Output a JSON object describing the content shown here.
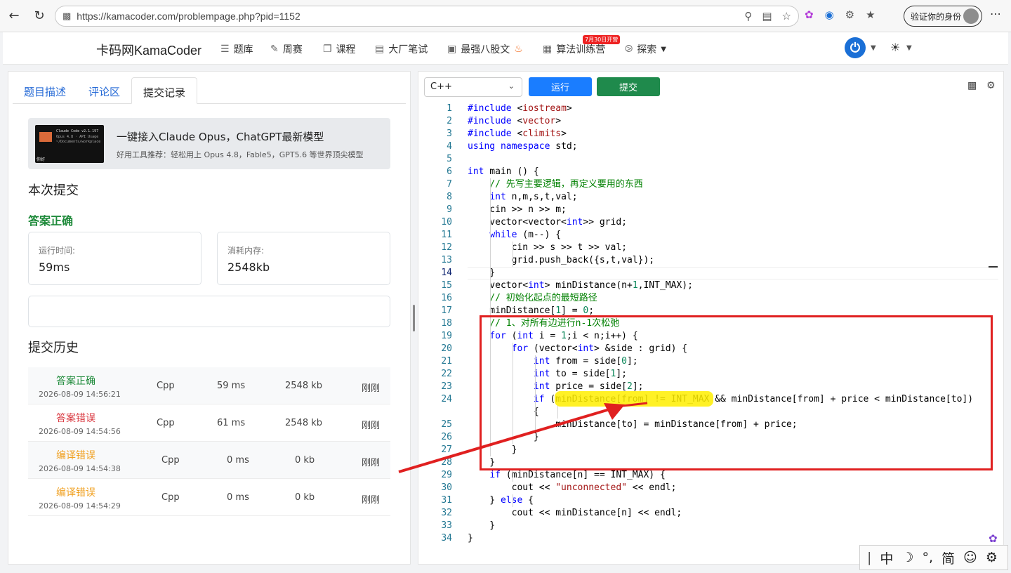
{
  "browser": {
    "url": "https://kamacoder.com/problempage.php?pid=1152",
    "profile_label": "验证你的身份"
  },
  "site": {
    "brand": "卡码网KamaCoder",
    "nav": [
      {
        "label": "题库",
        "icon": "list-icon"
      },
      {
        "label": "周赛",
        "icon": "pencil-icon"
      },
      {
        "label": "课程",
        "icon": "copy-icon"
      },
      {
        "label": "大厂笔试",
        "icon": "document-icon"
      },
      {
        "label": "最强八股文",
        "icon": "book-icon"
      },
      {
        "label": "算法训练营",
        "icon": "calendar-icon"
      },
      {
        "label": "探索",
        "icon": "compass-icon"
      }
    ],
    "badge": "7月30日开营"
  },
  "left": {
    "tabs": [
      "题目描述",
      "评论区",
      "提交记录"
    ],
    "ad": {
      "title": "一键接入Claude Opus，ChatGPT最新模型",
      "subtitle": "好用工具推荐：轻松用上 Opus 4.8，Fable5，GPT5.6 等世界顶尖模型",
      "thumb_line1": "Claude Code v2.1.197",
      "thumb_line2": "Opus 4.8 · API Usage",
      "thumb_line3": "~/Documents/workplace",
      "thumb_caption": "你好"
    },
    "current_title": "本次提交",
    "status": "答案正确",
    "runtime_label": "运行时间:",
    "runtime_value": "59ms",
    "memory_label": "消耗内存:",
    "memory_value": "2548kb",
    "history_title": "提交历史",
    "history": [
      {
        "status": "答案正确",
        "time": "2026-08-09 14:56:21",
        "lang": "Cpp",
        "ms": "59 ms",
        "kb": "2548 kb",
        "when": "刚刚"
      },
      {
        "status": "答案错误",
        "time": "2026-08-09 14:54:56",
        "lang": "Cpp",
        "ms": "61 ms",
        "kb": "2548 kb",
        "when": "刚刚"
      },
      {
        "status": "编译错误",
        "time": "2026-08-09 14:54:38",
        "lang": "Cpp",
        "ms": "0 ms",
        "kb": "0 kb",
        "when": "刚刚"
      },
      {
        "status": "编译错误",
        "time": "2026-08-09 14:54:29",
        "lang": "Cpp",
        "ms": "0 ms",
        "kb": "0 kb",
        "when": "刚刚"
      }
    ]
  },
  "editor": {
    "language": "C++",
    "run_label": "运行",
    "submit_label": "提交",
    "lines": [
      "#include <iostream>",
      "#include <vector>",
      "#include <climits>",
      "using namespace std;",
      "",
      "int main () {",
      "    // 先写主要逻辑，再定义要用的东西",
      "    int n,m,s,t,val;",
      "    cin >> n >> m;",
      "    vector<vector<int>> grid;",
      "    while (m--) {",
      "        cin >> s >> t >> val;",
      "        grid.push_back({s,t,val});",
      "    }",
      "    vector<int> minDistance(n+1,INT_MAX);",
      "    // 初始化起点的最短路径",
      "    minDistance[1] = 0;",
      "    // 1、对所有边进行n-1次松弛",
      "    for (int i = 1;i < n;i++) {",
      "        for (vector<int> &side : grid) {",
      "            int from = side[0];",
      "            int to = side[1];",
      "            int price = side[2];",
      "            if (minDistance[from] != INT_MAX && minDistance[from] + price < minDistance[to])",
      "            {",
      "                minDistance[to] = minDistance[from] + price;",
      "            }",
      "        }",
      "    }",
      "    if (minDistance[n] == INT_MAX) {",
      "        cout << \"unconnected\" << endl;",
      "    } else {",
      "        cout << minDistance[n] << endl;",
      "    }",
      "}"
    ],
    "line_numbers": [
      "1",
      "2",
      "3",
      "4",
      "5",
      "6",
      "7",
      "8",
      "9",
      "10",
      "11",
      "12",
      "13",
      "14",
      "15",
      "16",
      "17",
      "18",
      "19",
      "20",
      "21",
      "22",
      "23",
      "24",
      "",
      "25",
      "26",
      "27",
      "28",
      "29",
      "30",
      "31",
      "32",
      "33",
      "34"
    ]
  },
  "ime": {
    "items": [
      "中",
      "☽",
      "°,",
      "简",
      "☺",
      "⚙"
    ]
  }
}
